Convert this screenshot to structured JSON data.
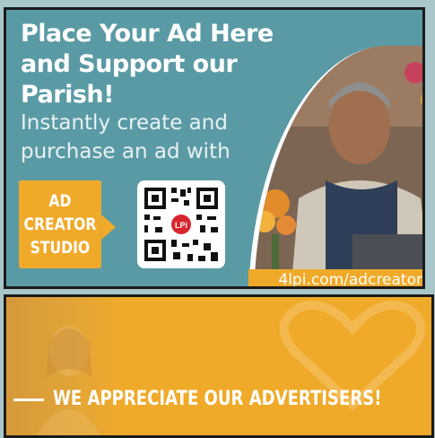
{
  "ad_top": {
    "headline": "Place Your Ad Here and Support our Parish!",
    "subtext": "Instantly create and purchase an ad with",
    "studio_lines": [
      "AD",
      "CREATOR",
      "STUDIO"
    ],
    "qr_center_label": "LPi",
    "url": "4lpi.com/adcreator",
    "colors": {
      "background": "#5a9aa5",
      "accent": "#f0aa29",
      "text": "#ffffff"
    }
  },
  "ad_bottom": {
    "banner_text": "WE APPRECIATE OUR ADVERTISERS!",
    "colors": {
      "background": "#f0aa29",
      "text": "#ffffff"
    }
  }
}
